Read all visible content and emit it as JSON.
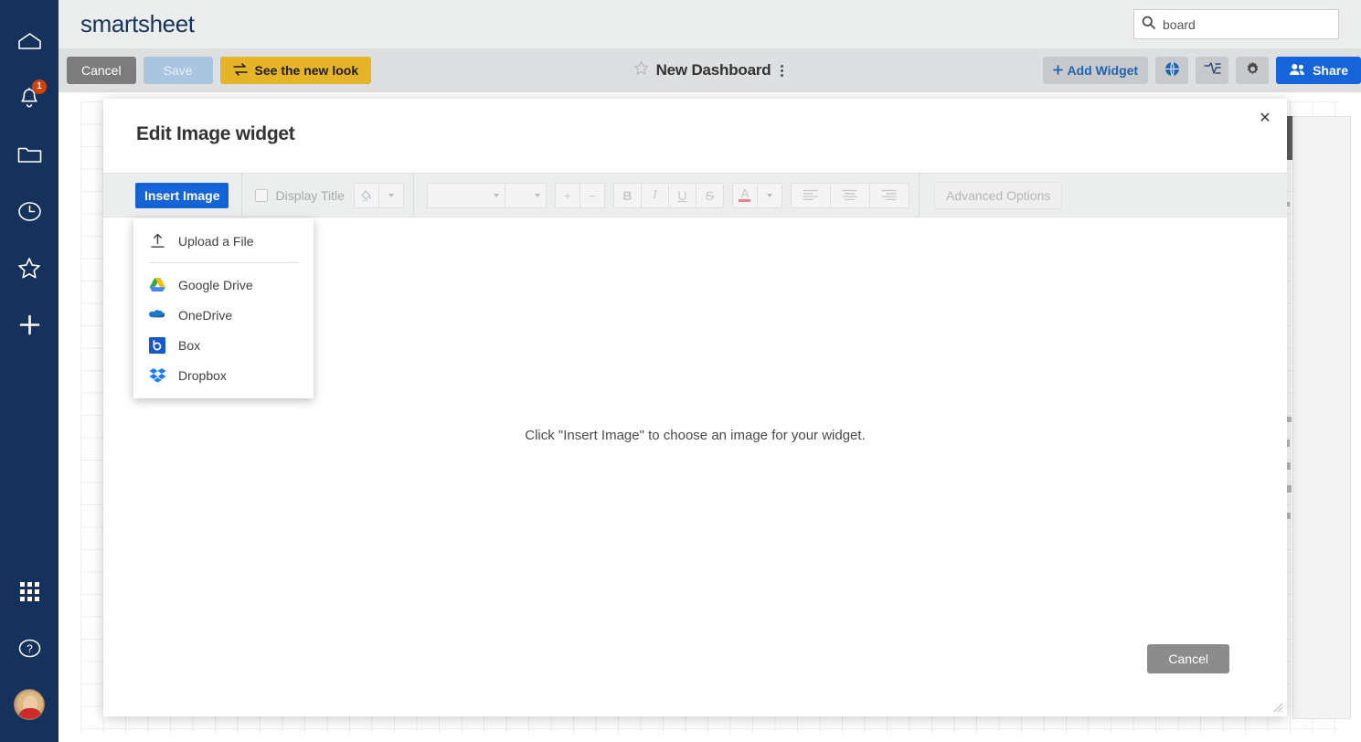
{
  "rail": {
    "items": [
      {
        "icon": "home-icon",
        "label": "Home"
      },
      {
        "icon": "bell-icon",
        "label": "Notifications",
        "badge": "1"
      },
      {
        "icon": "folder-icon",
        "label": "Browse"
      },
      {
        "icon": "clock-icon",
        "label": "Recents"
      },
      {
        "icon": "star-icon",
        "label": "Favorites"
      },
      {
        "icon": "plus-icon",
        "label": "Create"
      }
    ],
    "bottom_items": [
      {
        "icon": "grid-apps-icon",
        "label": "Apps"
      },
      {
        "icon": "help-circle-icon",
        "label": "Help"
      },
      {
        "icon": "avatar",
        "label": "Account"
      }
    ]
  },
  "topbar": {
    "logo": "smartsheet",
    "search": {
      "value": "board",
      "placeholder": "Search",
      "icon": "search-icon"
    }
  },
  "actionbar": {
    "cancel_label": "Cancel",
    "save_label": "Save",
    "new_look_label": "See the new look",
    "new_look_icon": "swap-arrows-icon",
    "favorite_icon": "star-outline-icon",
    "dashboard_title": "New Dashboard",
    "more_icon": "kebab-menu-icon",
    "add_widget_label": "Add Widget",
    "add_widget_icon": "plus-icon",
    "globe_icon": "globe-icon",
    "publish_icon": "activity-log-icon",
    "settings_icon": "gear-icon",
    "share_label": "Share",
    "share_icon": "people-icon"
  },
  "modal": {
    "title": "Edit Image widget",
    "close_icon": "close-icon",
    "toolbar": {
      "insert_image_label": "Insert Image",
      "display_title_label": "Display Title",
      "fill_color_icon": "paint-bucket-icon",
      "font_family_value": "",
      "font_size_value": "",
      "increase_font_label": "+",
      "decrease_font_label": "−",
      "bold_label": "B",
      "italic_label": "I",
      "underline_label": "U",
      "strikethrough_label": "S",
      "font_color_label": "A",
      "align_left_icon": "align-left-icon",
      "align_center_icon": "align-center-icon",
      "align_right_icon": "align-right-icon",
      "advanced_options_label": "Advanced Options"
    },
    "empty_message": "Click \"Insert Image\" to choose an image for your widget.",
    "cancel_label": "Cancel",
    "resize_icon": "resize-grip-icon"
  },
  "dropdown": {
    "items": [
      {
        "icon": "upload-icon",
        "label": "Upload a File"
      },
      {
        "separator": true
      },
      {
        "icon": "google-drive-icon",
        "label": "Google Drive"
      },
      {
        "icon": "onedrive-icon",
        "label": "OneDrive"
      },
      {
        "icon": "box-icon",
        "label": "Box"
      },
      {
        "icon": "dropbox-icon",
        "label": "Dropbox"
      }
    ]
  },
  "colors": {
    "rail_bg": "#14325c",
    "topbar_bg": "#eceded",
    "actionbar_bg": "#dedfe0",
    "primary_blue": "#1565d8",
    "new_look_yellow": "#e6b428",
    "badge_red": "#d0430f",
    "gray_button": "#7c7c7c",
    "logo_navy": "#16345d"
  }
}
